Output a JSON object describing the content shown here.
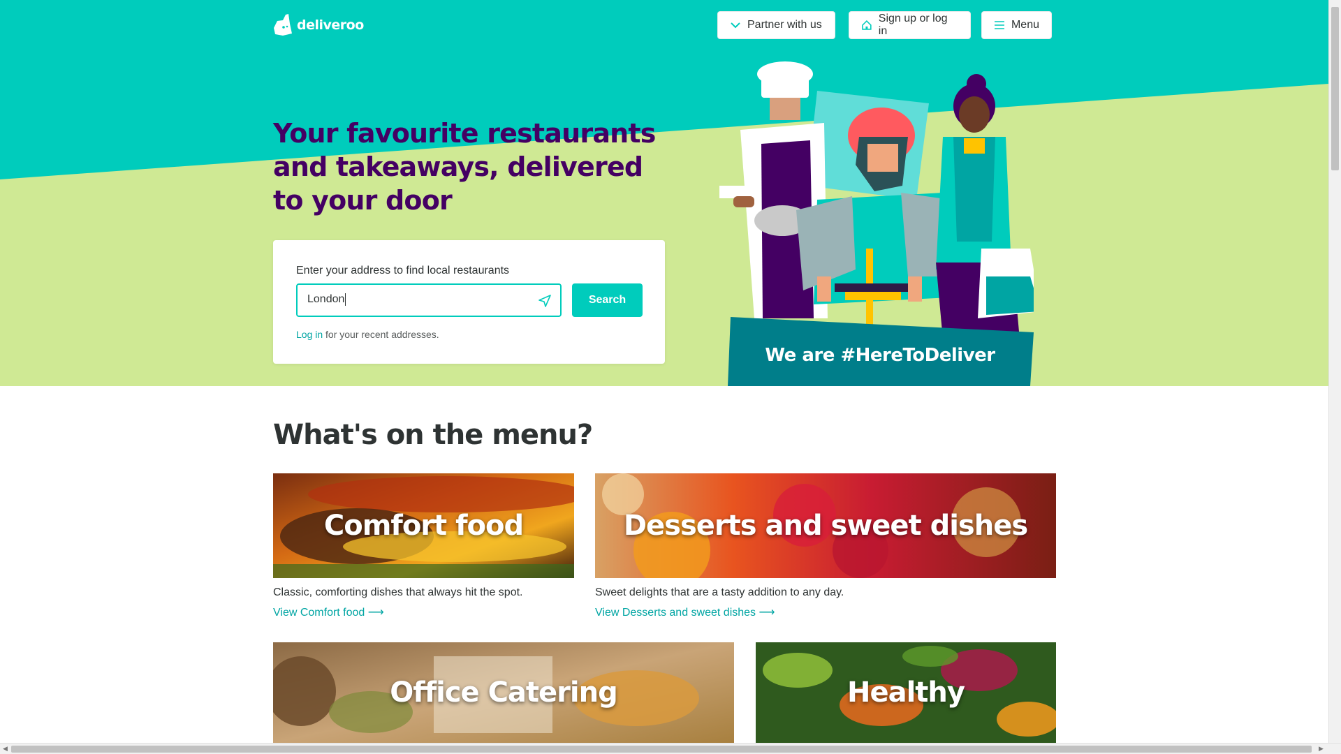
{
  "brand": {
    "name": "deliveroo",
    "primary_color": "#00ccbc",
    "headline_color": "#440063",
    "hero_green": "#cfe994"
  },
  "nav": {
    "partner_label": "Partner with us",
    "signup_label": "Sign up or log in",
    "menu_label": "Menu"
  },
  "hero": {
    "headline": "Your favourite restaurants and takeaways, delivered to your door",
    "search_label": "Enter your address to find local restaurants",
    "address_value": "London",
    "search_button": "Search",
    "login_link": "Log in",
    "recent_note": " for your recent addresses.",
    "banner": "We are #HereToDeliver"
  },
  "menu": {
    "title": "What's on the menu?",
    "categories": [
      {
        "title": "Comfort food",
        "description": "Classic, comforting dishes that always hit the spot.",
        "link": "View Comfort food ⟶"
      },
      {
        "title": "Desserts and sweet dishes",
        "description": "Sweet delights that are a tasty addition to any day.",
        "link": "View Desserts and sweet dishes ⟶"
      },
      {
        "title": "Office Catering",
        "description": "",
        "link": ""
      },
      {
        "title": "Healthy",
        "description": "",
        "link": ""
      }
    ]
  }
}
